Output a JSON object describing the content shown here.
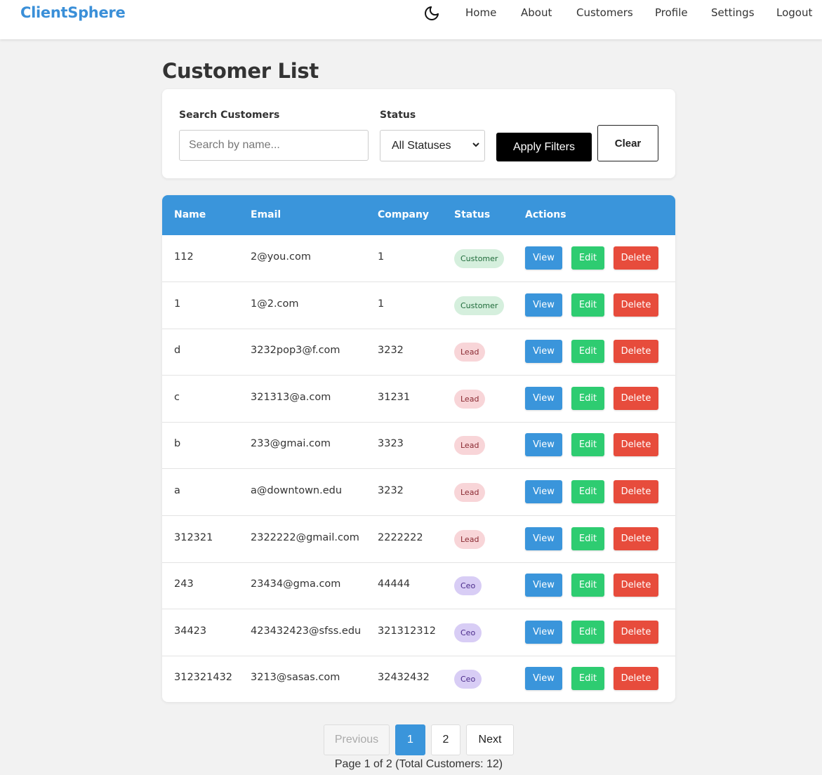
{
  "nav": {
    "brand": "ClientSphere",
    "theme_icon": "moon-icon",
    "links": [
      "Home",
      "About",
      "Customers",
      "Profile",
      "Settings",
      "Logout"
    ]
  },
  "page": {
    "title": "Customer List"
  },
  "filters": {
    "search_label": "Search Customers",
    "search_placeholder": "Search by name...",
    "search_value": "",
    "status_label": "Status",
    "status_selected": "All Statuses",
    "apply_label": "Apply Filters",
    "clear_label": "Clear"
  },
  "table": {
    "headers": [
      "Name",
      "Email",
      "Company",
      "Status",
      "Actions"
    ],
    "actions": {
      "view": "View",
      "edit": "Edit",
      "delete": "Delete"
    },
    "rows": [
      {
        "name": "112",
        "email": "2@you.com",
        "company": "1",
        "status": "Customer"
      },
      {
        "name": "1",
        "email": "1@2.com",
        "company": "1",
        "status": "Customer"
      },
      {
        "name": "d",
        "email": "3232pop3@f.com",
        "company": "3232",
        "status": "Lead"
      },
      {
        "name": "c",
        "email": "321313@a.com",
        "company": "31231",
        "status": "Lead"
      },
      {
        "name": "b",
        "email": "233@gmai.com",
        "company": "3323",
        "status": "Lead"
      },
      {
        "name": "a",
        "email": "a@downtown.edu",
        "company": "3232",
        "status": "Lead"
      },
      {
        "name": "312321",
        "email": "2322222@gmail.com",
        "company": "2222222",
        "status": "Lead"
      },
      {
        "name": "243",
        "email": "23434@gma.com",
        "company": "44444",
        "status": "Ceo"
      },
      {
        "name": "34423",
        "email": "423432423@sfss.edu",
        "company": "321312312",
        "status": "Ceo"
      },
      {
        "name": "312321432",
        "email": "3213@sasas.com",
        "company": "32432432",
        "status": "Ceo"
      }
    ]
  },
  "pagination": {
    "prev": "Previous",
    "pages": [
      "1",
      "2"
    ],
    "next": "Next",
    "info": "Page 1 of 2 (Total Customers: 12)"
  },
  "colors": {
    "brand": "#3a8fd8",
    "header_bg": "#3a95db",
    "view": "#3a95db",
    "edit": "#2ecc71",
    "delete": "#e74c3c"
  }
}
